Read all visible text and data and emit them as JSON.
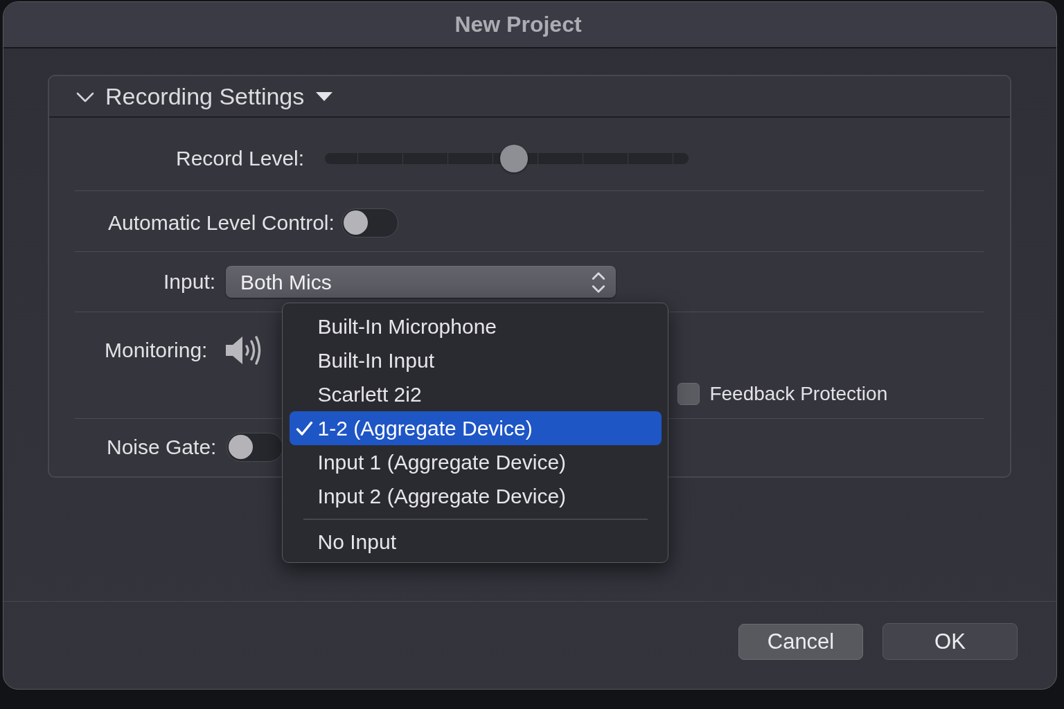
{
  "window": {
    "title": "New Project"
  },
  "section": {
    "title": "Recording Settings",
    "expanded": true,
    "rows": [
      {
        "kind": "slider",
        "label": "Record Level:",
        "level": 0.52
      },
      {
        "kind": "toggle",
        "label": "Automatic Level Control:",
        "on": false
      },
      {
        "kind": "popup",
        "label": "Input:",
        "value": "Both Mics",
        "menu": {
          "groups": [
            [
              {
                "label": "Built-In Microphone",
                "selected": false
              },
              {
                "label": "Built-In Input",
                "selected": false
              },
              {
                "label": "Scarlett 2i2",
                "selected": false
              },
              {
                "label": "1-2 (Aggregate Device)",
                "selected": true
              },
              {
                "label": "Input 1 (Aggregate Device)",
                "selected": false
              },
              {
                "label": "Input 2 (Aggregate Device)",
                "selected": false
              }
            ],
            [
              {
                "label": "No Input",
                "selected": false
              }
            ]
          ]
        }
      },
      {
        "kind": "monitoring",
        "label": "Monitoring:",
        "checkbox": {
          "label": "Feedback Protection",
          "checked": false
        }
      },
      {
        "kind": "toggle",
        "label": "Noise Gate:",
        "on": false
      }
    ]
  },
  "buttons": [
    {
      "label": "Cancel",
      "kind": "cancel"
    },
    {
      "label": "OK",
      "kind": "default"
    }
  ]
}
